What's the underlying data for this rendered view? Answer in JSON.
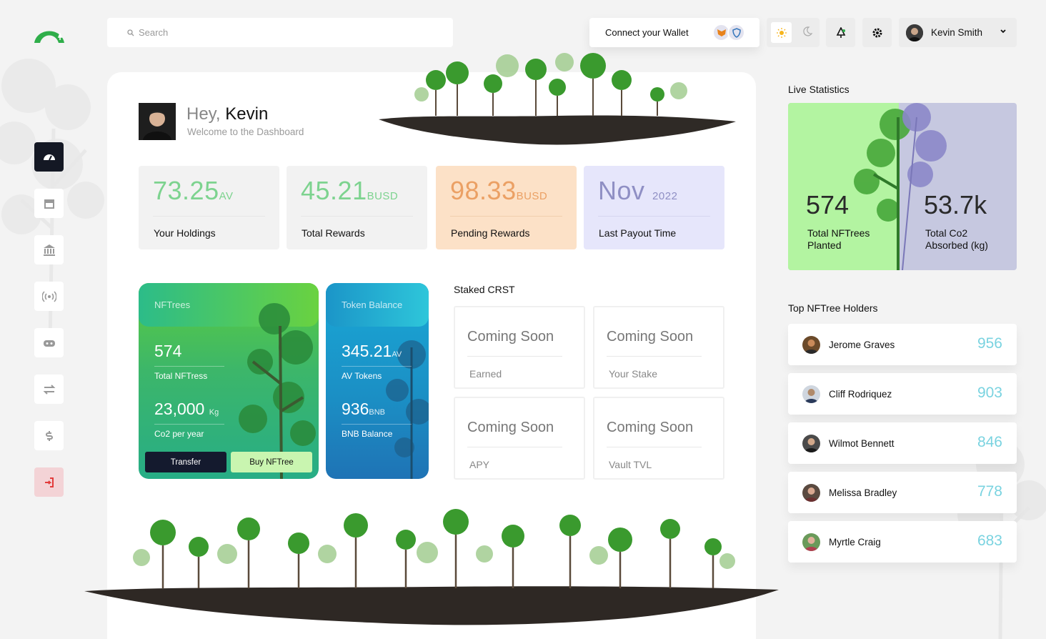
{
  "search": {
    "placeholder": "Search"
  },
  "wallet": {
    "label": "Connect your Wallet"
  },
  "user": {
    "name": "Kevin Smith"
  },
  "hero": {
    "greeting": "Hey,",
    "name": "Kevin",
    "subtitle": "Welcome to the Dashboard"
  },
  "stats": [
    {
      "value": "73.25",
      "unit": "AV",
      "label": "Your Holdings",
      "bg": "#f2f2f2",
      "color": "#7dd38f"
    },
    {
      "value": "45.21",
      "unit": "BUSD",
      "label": "Total Rewards",
      "bg": "#f2f2f2",
      "color": "#7dd38f"
    },
    {
      "value": "98.33",
      "unit": "BUSD",
      "label": "Pending Rewards",
      "bg": "#fce1c7",
      "color": "#eba064"
    },
    {
      "value": "Nov",
      "unit": "2022",
      "label": "Last Payout Time",
      "bg": "#e6e6fb",
      "color": "#8f8fc4"
    }
  ],
  "nftrees": {
    "title": "NFTrees",
    "total_value": "574",
    "total_label": "Total NFTress",
    "co2_value": "23,000",
    "co2_unit": "Kg",
    "co2_label": "Co2 per year",
    "transfer_label": "Transfer",
    "buy_label": "Buy NFTree"
  },
  "token": {
    "title": "Token Balance",
    "av_value": "345.21",
    "av_unit": "AV",
    "av_label": "AV Tokens",
    "bnb_value": "936",
    "bnb_unit": "BNB",
    "bnb_label": "BNB Balance"
  },
  "staked": {
    "title": "Staked CRST",
    "items": [
      {
        "value": "Coming Soon",
        "label": "Earned"
      },
      {
        "value": "Coming Soon",
        "label": "Your Stake"
      },
      {
        "value": "Coming Soon",
        "label": "APY"
      },
      {
        "value": "Coming Soon",
        "label": "Vault TVL"
      }
    ]
  },
  "live": {
    "title": "Live Statistics",
    "planted_value": "574",
    "planted_label_1": "Total NFTrees",
    "planted_label_2": "Planted",
    "co2_value": "53.7k",
    "co2_label_1": "Total Co2",
    "co2_label_2": "Absorbed (kg)"
  },
  "holders": {
    "title": "Top NFTree Holders",
    "items": [
      {
        "name": "Jerome Graves",
        "value": "956"
      },
      {
        "name": "Cliff Rodriquez",
        "value": "903"
      },
      {
        "name": "Wilmot Bennett",
        "value": "846"
      },
      {
        "name": "Melissa Bradley",
        "value": "778"
      },
      {
        "name": "Myrtle Craig",
        "value": "683"
      }
    ]
  },
  "icons": {
    "sidebar": [
      "dashboard-icon",
      "store-icon",
      "bank-icon",
      "broadcast-icon",
      "gamepad-icon",
      "transfer-icon",
      "dollar-icon",
      "logout-icon"
    ],
    "top": [
      "search-icon",
      "metamask-icon",
      "trustwallet-icon",
      "sun-icon",
      "moon-icon",
      "tree-notification-icon",
      "gear-icon",
      "chevron-down-icon"
    ]
  },
  "colors": {
    "accent_green": "#3cb66a",
    "dark": "#141824",
    "holder_value": "#7ad3e0",
    "logout_bg": "#f3d3d6"
  }
}
